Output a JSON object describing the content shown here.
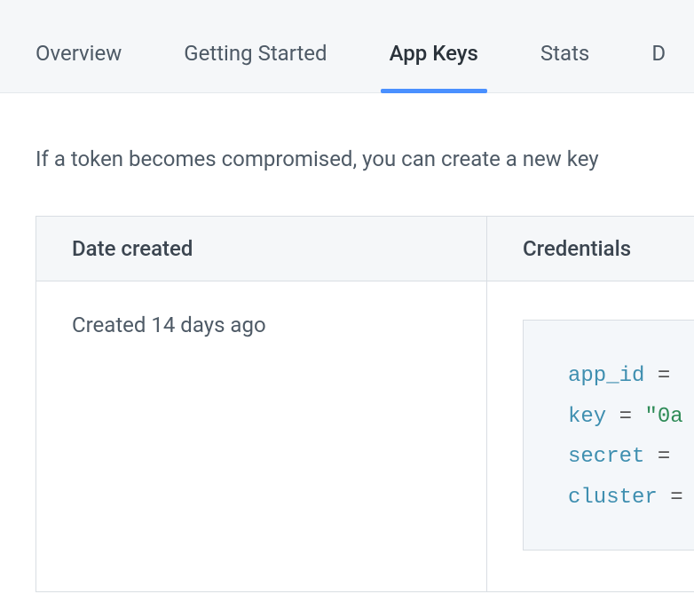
{
  "tabs": [
    {
      "label": "Overview",
      "active": false
    },
    {
      "label": "Getting Started",
      "active": false
    },
    {
      "label": "App Keys",
      "active": true
    },
    {
      "label": "Stats",
      "active": false
    },
    {
      "label": "D",
      "active": false
    }
  ],
  "intro_text": "If a token becomes compromised, you can create a new key",
  "table": {
    "headers": {
      "date": "Date created",
      "credentials": "Credentials"
    },
    "rows": [
      {
        "date_text": "Created 14 days ago",
        "credentials": {
          "app_id_label": "app_id",
          "key_label": "key",
          "key_value": "\"0a",
          "secret_label": "secret",
          "cluster_label": "cluster",
          "eq": "="
        }
      }
    ]
  }
}
